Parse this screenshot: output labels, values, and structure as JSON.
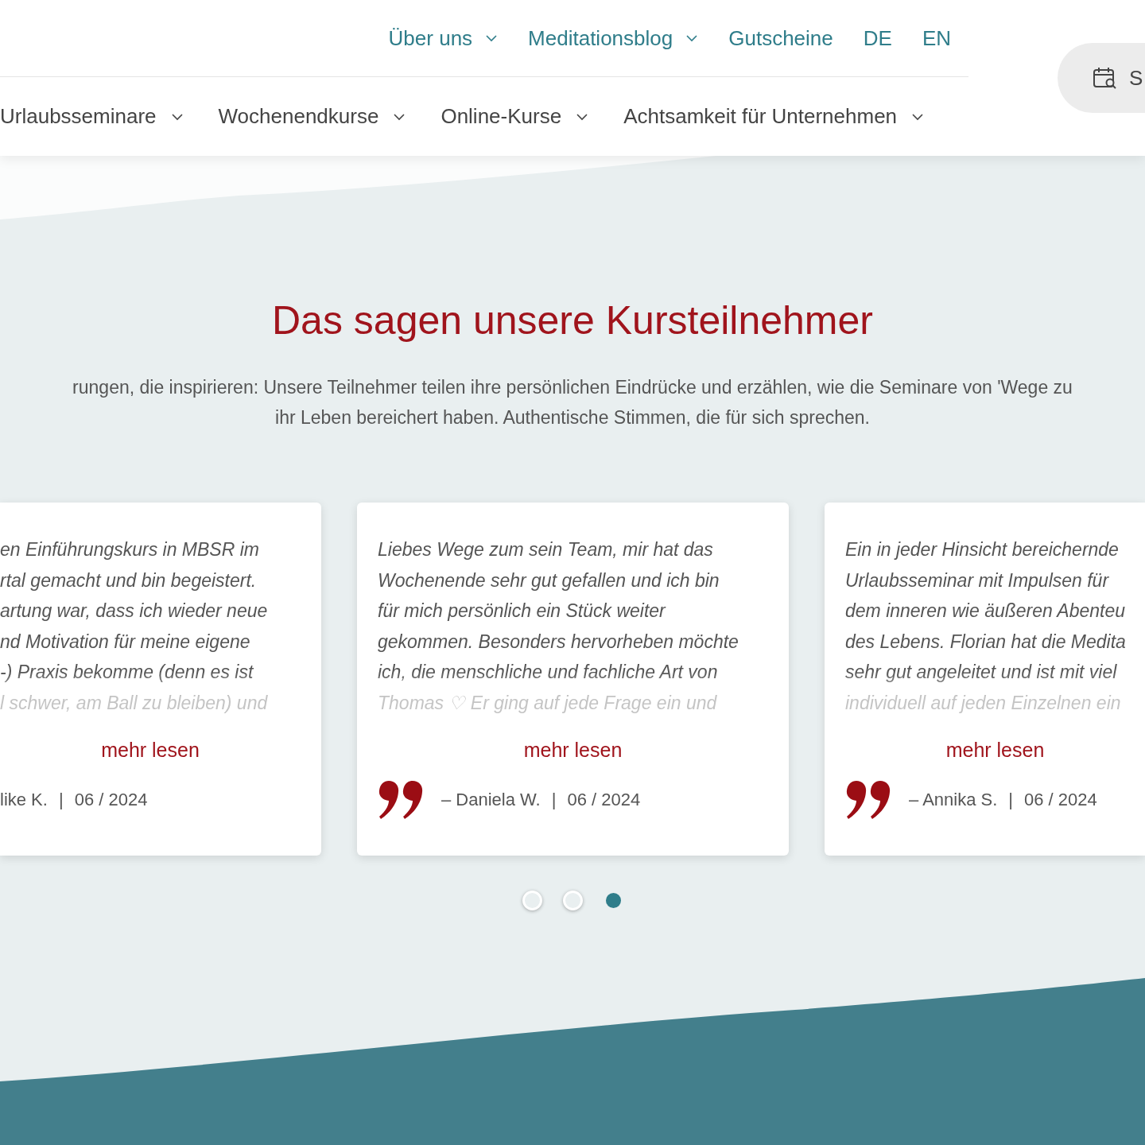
{
  "header": {
    "top_links": [
      {
        "label": "Über uns",
        "dropdown": true
      },
      {
        "label": "Meditationsblog",
        "dropdown": true
      },
      {
        "label": "Gutscheine",
        "dropdown": false
      },
      {
        "label": "DE",
        "dropdown": false
      },
      {
        "label": "EN",
        "dropdown": false
      }
    ],
    "main_links": [
      {
        "label": "Urlaubsseminare",
        "dropdown": true
      },
      {
        "label": "Wochenendkurse",
        "dropdown": true
      },
      {
        "label": "Online-Kurse",
        "dropdown": true
      },
      {
        "label": "Achtsamkeit für Unternehmen",
        "dropdown": true
      }
    ],
    "booking_button": {
      "label": "S"
    }
  },
  "testimonials": {
    "title": "Das sagen unsere Kursteilnehmer",
    "intro": "rungen, die inspirieren: Unsere Teilnehmer teilen ihre persönlichen Eindrücke und erzählen, wie die Seminare von 'Wege zu\nihr Leben bereichert haben. Authentische Stimmen, die für sich sprechen.",
    "cards": [
      {
        "text": "en Einführungskurs in MBSR im\nrtal gemacht und bin begeistert.\nartung war, dass ich wieder neue\nnd Motivation für meine eigene\n-) Praxis bekomme (denn es ist\nl schwer, am Ball zu bleiben) und",
        "more": "mehr lesen",
        "quote_mark": false,
        "author": "like K.",
        "separator": "|",
        "date": "06 / 2024"
      },
      {
        "text": "Liebes Wege zum sein Team, mir hat das\nWochenende sehr gut gefallen und ich bin\nfür mich persönlich ein Stück weiter\ngekommen. Besonders hervorheben möchte\nich, die menschliche und fachliche Art von\nThomas ♡ Er ging auf jede Frage ein und",
        "more": "mehr lesen",
        "quote_mark": true,
        "author": "–  Daniela W.",
        "separator": "|",
        "date": "06 / 2024"
      },
      {
        "text": "Ein in jeder Hinsicht bereichernde\nUrlaubsseminar mit Impulsen für\ndem inneren wie äußeren Abenteu\ndes Lebens. Florian hat die Medita\nsehr gut angeleitet und ist mit viel\nindividuell auf jeden Einzelnen ein",
        "more": "mehr lesen",
        "quote_mark": true,
        "author": "–  Annika S.",
        "separator": "|",
        "date": "06 / 2024"
      }
    ],
    "dots": [
      {
        "selected": false
      },
      {
        "selected": false
      },
      {
        "selected": true
      }
    ]
  }
}
